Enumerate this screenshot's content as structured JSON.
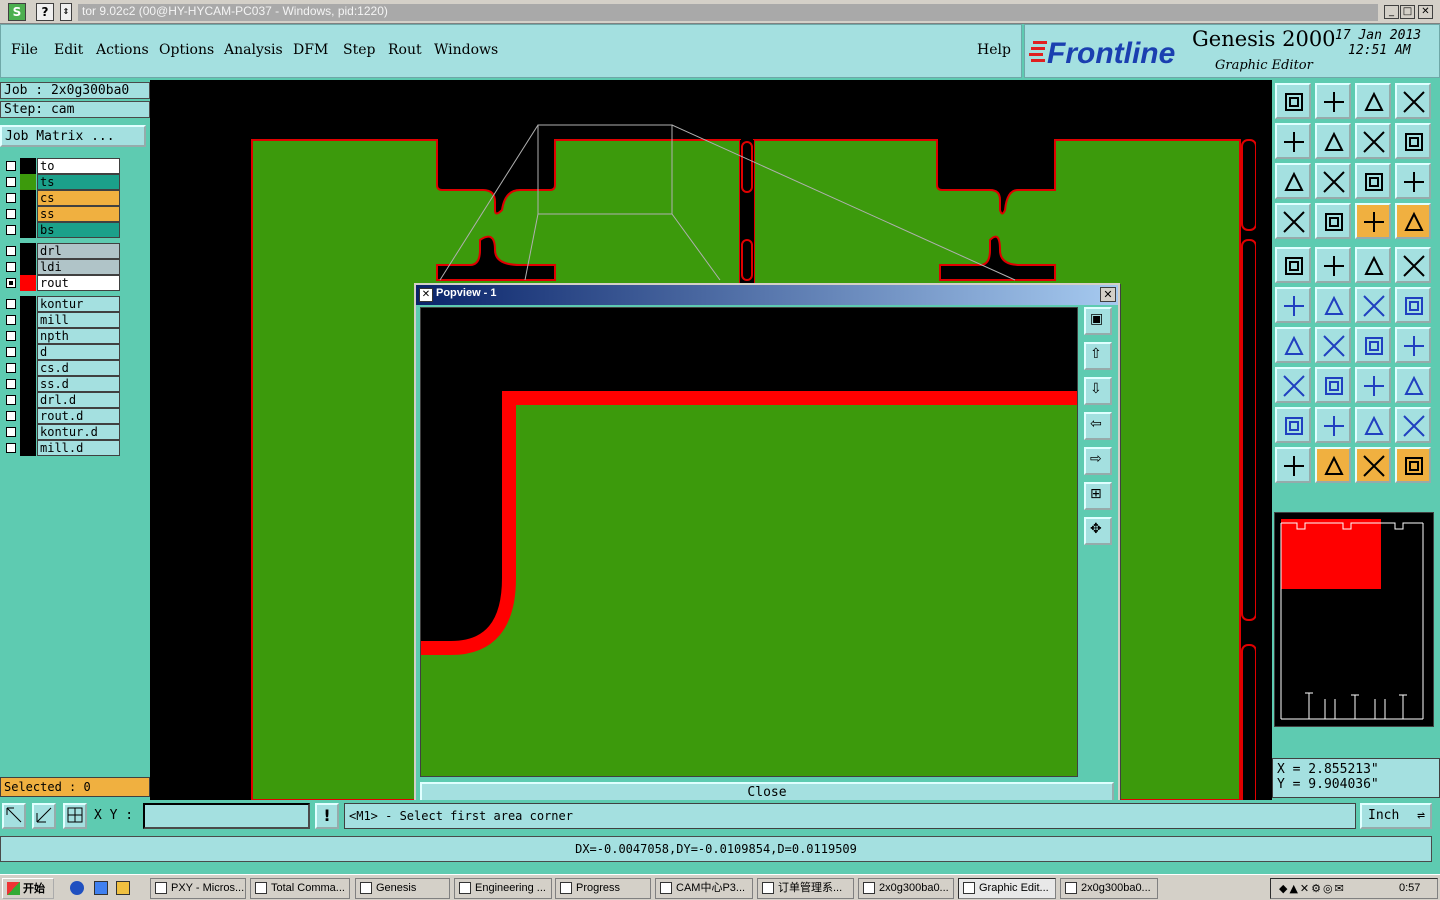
{
  "titlebar": {
    "title": "tor 9.02c2 (00@HY-HYCAM-PC037 - Windows, pid:1220)",
    "btn_s": "S",
    "btn_q": "?",
    "btn_min": "_",
    "btn_max": "□",
    "btn_close": "✕"
  },
  "menu": {
    "items": [
      "File",
      "Edit",
      "Actions",
      "Options",
      "Analysis",
      "DFM",
      "Step",
      "Rout",
      "Windows"
    ],
    "help": "Help"
  },
  "logo": {
    "brand": "Frontline",
    "product": "Genesis 2000",
    "subtitle": "Graphic Editor",
    "date": "17 Jan 2013",
    "time": "12:51 AM"
  },
  "job": {
    "job_line": "Job : 2x0g300ba0",
    "step_line": "Step: cam",
    "matrix_button": "Job Matrix ..."
  },
  "layers": {
    "group1": [
      {
        "name": "to",
        "color": "#ffffff",
        "swatch": "#000000",
        "on": false
      },
      {
        "name": "ts",
        "color": "#1ba08a",
        "swatch": "#3c9a0c",
        "on": false
      },
      {
        "name": "cs",
        "color": "#f0b040",
        "swatch": "#000000",
        "on": false
      },
      {
        "name": "ss",
        "color": "#f0b040",
        "swatch": "#000000",
        "on": false
      },
      {
        "name": "bs",
        "color": "#1ba08a",
        "swatch": "#000000",
        "on": false
      }
    ],
    "group2": [
      {
        "name": "drl",
        "color": "#b0c4c8",
        "swatch": "#000000",
        "on": false
      },
      {
        "name": "ldi",
        "color": "#b0c4c8",
        "swatch": "#000000",
        "on": false
      },
      {
        "name": "rout",
        "color": "#ffffff",
        "swatch": "#ff0000",
        "on": true
      }
    ],
    "group3": [
      {
        "name": "kontur",
        "color": "#a4e0e0",
        "swatch": "#000000",
        "on": false
      },
      {
        "name": "mill",
        "color": "#a4e0e0",
        "swatch": "#000000",
        "on": false
      },
      {
        "name": "npth",
        "color": "#a4e0e0",
        "swatch": "#000000",
        "on": false
      },
      {
        "name": "d",
        "color": "#a4e0e0",
        "swatch": "#000000",
        "on": false
      },
      {
        "name": "cs.d",
        "color": "#a4e0e0",
        "swatch": "#000000",
        "on": false
      },
      {
        "name": "ss.d",
        "color": "#a4e0e0",
        "swatch": "#000000",
        "on": false
      },
      {
        "name": "drl.d",
        "color": "#a4e0e0",
        "swatch": "#000000",
        "on": false
      },
      {
        "name": "rout.d",
        "color": "#a4e0e0",
        "swatch": "#000000",
        "on": false
      },
      {
        "name": "kontur.d",
        "color": "#a4e0e0",
        "swatch": "#000000",
        "on": false
      },
      {
        "name": "mill.d",
        "color": "#a4e0e0",
        "swatch": "#000000",
        "on": false
      }
    ]
  },
  "selected": "Selected : 0",
  "popview": {
    "title": "Popview - 1",
    "close_label": "Close"
  },
  "coords": {
    "x_line": "X = 2.855213\"",
    "y_line": "Y = 9.904036\""
  },
  "command": {
    "xy_label": "X Y :",
    "xy_value": "",
    "excl": "!",
    "prompt": "<M1> - Select first area corner",
    "units": "Inch"
  },
  "dx": "DX=-0.0047058,DY=-0.0109854,D=0.0119509",
  "taskbar": {
    "start": "开始",
    "tasks": [
      "PXY - Micros...",
      "Total Comma...",
      "Genesis",
      "Engineering ...",
      "Progress",
      "CAM中心P3...",
      "订单管理系...",
      "2x0g300ba0...",
      "Graphic Edit...",
      "2x0g300ba0..."
    ],
    "clock": "0:57"
  },
  "colors": {
    "panel": "#5ecbb1",
    "light": "#a4e0e0",
    "board_green": "#3c9a0c",
    "rout_red": "#ff0000",
    "highlight": "#f0b040"
  }
}
